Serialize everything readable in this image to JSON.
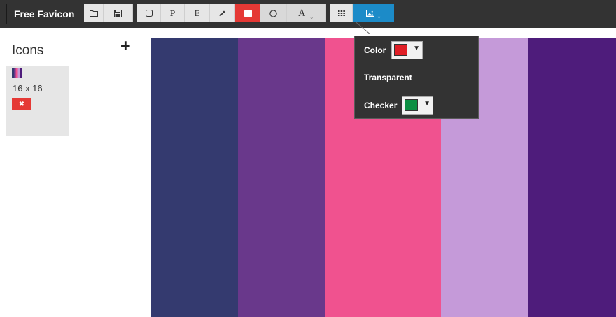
{
  "app": {
    "title": "Free Favicon"
  },
  "toolbar": {
    "open_icon": "folder-icon",
    "save_icon": "save-icon",
    "rect_icon": "square-outline-icon",
    "pencil_label": "P",
    "eraser_label": "E",
    "eyedropper_icon": "eyedropper-icon",
    "fill_rect_icon": "filled-square-icon",
    "circle_icon": "circle-outline-icon",
    "text_label": "A",
    "grid_icon": "grid-icon",
    "background_icon": "image-icon"
  },
  "sidebar": {
    "title": "Icons",
    "add_symbol": "+",
    "icon_card": {
      "size_label": "16 x 16",
      "delete_symbol": "✖"
    }
  },
  "canvas": {
    "colors": [
      "#343a6f",
      "#69388b",
      "#f0528f",
      "#c59ad9",
      "#4e1c7b"
    ]
  },
  "background_menu": {
    "color_label": "Color",
    "color_value": "#e01f26",
    "transparent_label": "Transparent",
    "checker_label": "Checker",
    "checker_value": "#0c8f43",
    "dropdown_symbol": "▼"
  },
  "accent": {
    "red": "#e53935",
    "blue": "#1c8bc8",
    "toolbar_bg": "#333333"
  }
}
